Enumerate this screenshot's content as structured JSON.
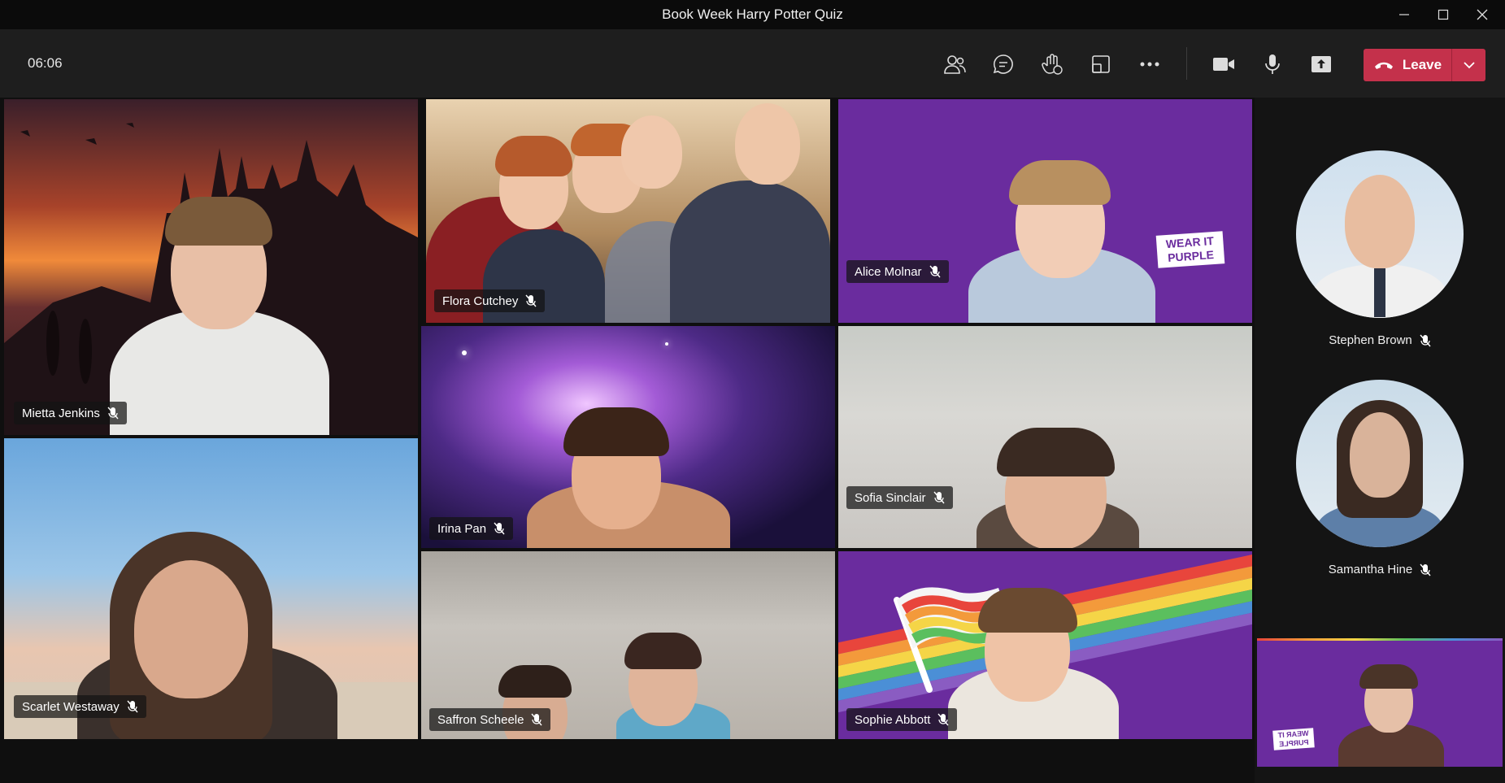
{
  "window": {
    "title": "Book Week Harry Potter Quiz"
  },
  "call": {
    "timer": "06:06",
    "leave_label": "Leave"
  },
  "toolbar_icons": [
    "people-icon",
    "chat-icon",
    "raise-hand-icon",
    "rooms-icon",
    "more-icon",
    "camera-icon",
    "microphone-icon",
    "share-tray-icon"
  ],
  "participants": {
    "p1": {
      "name": "Mietta Jenkins",
      "muted": true
    },
    "p2": {
      "name": "Flora Cutchey",
      "muted": true
    },
    "p3": {
      "name": "Alice Molnar",
      "muted": true
    },
    "p4": {
      "name": "Irina Pan",
      "muted": true
    },
    "p5": {
      "name": "Sofia Sinclair",
      "muted": true
    },
    "p6": {
      "name": "Scarlet Westaway",
      "muted": true
    },
    "p7": {
      "name": "Saffron Scheele",
      "muted": true
    },
    "p8": {
      "name": "Sophie Abbott",
      "muted": true
    },
    "p9": {
      "name": "Stephen Brown",
      "muted": true
    },
    "p10": {
      "name": "Samantha Hine",
      "muted": true
    }
  },
  "backgrounds": {
    "wear_it_purple": "WEAR IT PURPLE"
  },
  "colors": {
    "leave": "#c4314b",
    "purple_bg": "#6a2c9e",
    "toolbar": "#1e1e1e"
  }
}
